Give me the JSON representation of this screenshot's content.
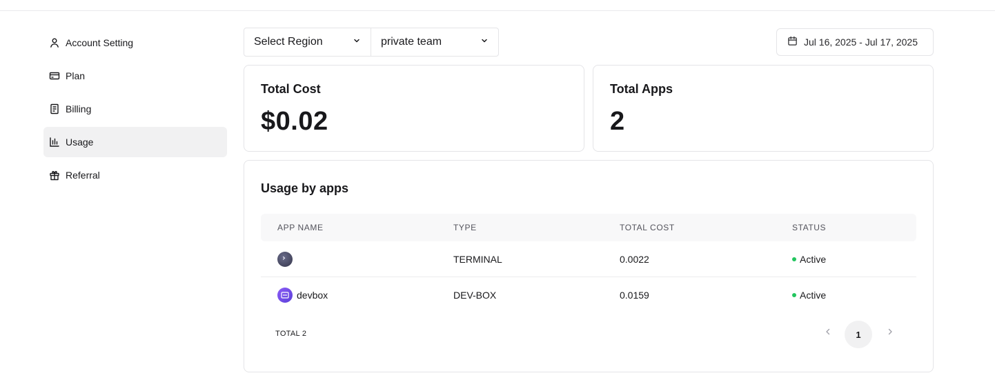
{
  "sidebar": {
    "items": [
      {
        "label": "Account Setting",
        "icon": "user-icon"
      },
      {
        "label": "Plan",
        "icon": "credit-card-icon"
      },
      {
        "label": "Billing",
        "icon": "receipt-icon"
      },
      {
        "label": "Usage",
        "icon": "bar-chart-icon",
        "active": true
      },
      {
        "label": "Referral",
        "icon": "gift-icon"
      }
    ]
  },
  "filters": {
    "region": "Select Region",
    "team": "private team",
    "date_range": "Jul 16, 2025 - Jul 17, 2025"
  },
  "summary": {
    "total_cost_label": "Total Cost",
    "total_cost_value": "$0.02",
    "total_apps_label": "Total Apps",
    "total_apps_value": "2"
  },
  "usage": {
    "title": "Usage by apps",
    "columns": [
      "APP NAME",
      "TYPE",
      "TOTAL COST",
      "STATUS"
    ],
    "rows": [
      {
        "name": "",
        "icon": "terminal-icon",
        "type": "TERMINAL",
        "cost": "0.0022",
        "status": "Active"
      },
      {
        "name": "devbox",
        "icon": "devbox-icon",
        "type": "DEV-BOX",
        "cost": "0.0159",
        "status": "Active"
      }
    ],
    "total_label": "TOTAL 2",
    "current_page": "1"
  },
  "colors": {
    "status_active": "#22c55e",
    "active_nav_bg": "#f1f1f2",
    "devbox_accent": "#7c4dee"
  }
}
